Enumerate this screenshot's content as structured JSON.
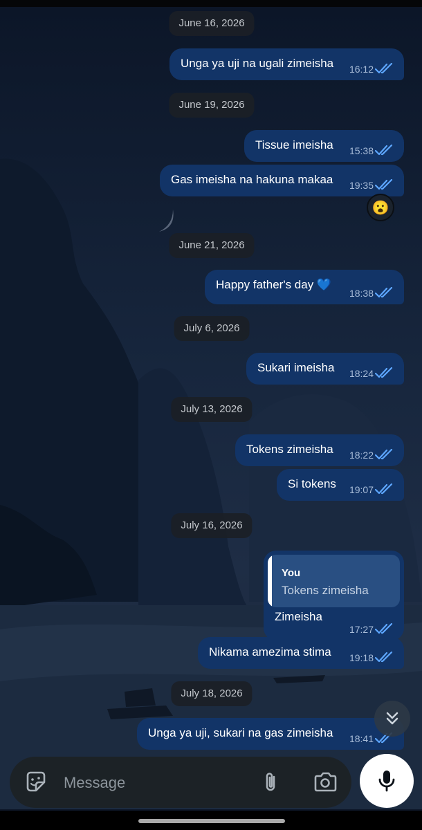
{
  "colors": {
    "bubble_out": "#123467",
    "date_pill": "#1b1f26",
    "read_ticks": "#5ea7ff",
    "composer_bg": "#1c2226",
    "mic_bg": "#ffffff"
  },
  "messages": [
    {
      "type": "date",
      "text": "June 16, 2026"
    },
    {
      "type": "out",
      "text": "Unga ya uji na ugali zimeisha",
      "time": "16:12",
      "status": "read"
    },
    {
      "type": "date",
      "text": "June 19, 2026"
    },
    {
      "type": "out",
      "text": "Tissue imeisha",
      "time": "15:38",
      "status": "read"
    },
    {
      "type": "out",
      "text": "Gas imeisha na hakuna makaa",
      "time": "19:35",
      "status": "read",
      "reaction": "😮"
    },
    {
      "type": "date",
      "text": "June 21, 2026"
    },
    {
      "type": "out",
      "text": "Happy father's day 💙",
      "time": "18:38",
      "status": "read"
    },
    {
      "type": "date",
      "text": "July 6, 2026"
    },
    {
      "type": "out",
      "text": "Sukari imeisha",
      "time": "18:24",
      "status": "read"
    },
    {
      "type": "date",
      "text": "July 13, 2026"
    },
    {
      "type": "out",
      "text": "Tokens zimeisha",
      "time": "18:22",
      "status": "read"
    },
    {
      "type": "out",
      "text": "Si tokens",
      "time": "19:07",
      "status": "read"
    },
    {
      "type": "date",
      "text": "July 16, 2026"
    },
    {
      "type": "out",
      "text": "Zimeisha",
      "time": "17:27",
      "status": "read",
      "reply_to": {
        "author": "You",
        "text": "Tokens zimeisha"
      }
    },
    {
      "type": "out",
      "text": "Nikama amezima stima",
      "time": "19:18",
      "status": "read"
    },
    {
      "type": "date",
      "text": "July 18, 2026"
    },
    {
      "type": "out",
      "text": "Unga ya uji, sukari na gas zimeisha",
      "time": "18:41",
      "status": "read"
    }
  ],
  "composer": {
    "placeholder": "Message",
    "sticker_icon": "sticker-icon",
    "attach_icon": "paperclip-icon",
    "camera_icon": "camera-icon",
    "mic_icon": "microphone-icon"
  },
  "scroll_button_icon": "double-chevron-down-icon"
}
